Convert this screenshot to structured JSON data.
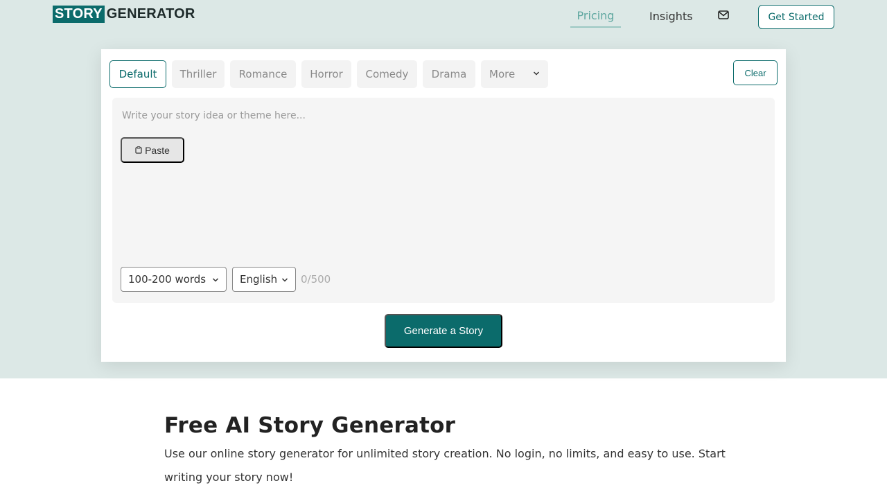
{
  "brand": {
    "logo_box": "STORY",
    "logo_rest": "GENERATOR"
  },
  "nav": {
    "pricing": "Pricing",
    "insights": "Insights",
    "mail_icon": "mail-icon",
    "get_started": "Get Started"
  },
  "tabs": [
    {
      "label": "Default",
      "active": true
    },
    {
      "label": "Thriller",
      "active": false
    },
    {
      "label": "Romance",
      "active": false
    },
    {
      "label": "Horror",
      "active": false
    },
    {
      "label": "Comedy",
      "active": false
    },
    {
      "label": "Drama",
      "active": false
    },
    {
      "label": "More",
      "active": false
    }
  ],
  "clear_label": "Clear",
  "editor": {
    "placeholder": "Write your story idea or theme here...",
    "paste_label": "Paste",
    "paste_icon": "clipboard-icon",
    "length_select": "100-200 words",
    "language_select": "English",
    "counter": "0/500"
  },
  "generate_label": "Generate a Story",
  "intro": {
    "title": "Free AI Story Generator",
    "text": "Use our online story generator for unlimited story creation. No login, no limits, and easy to use. Start writing your story now!"
  },
  "colors": {
    "accent": "#0b6b6b",
    "hero_bg": "#dce8e6",
    "pricing": "#5fa7a0"
  }
}
